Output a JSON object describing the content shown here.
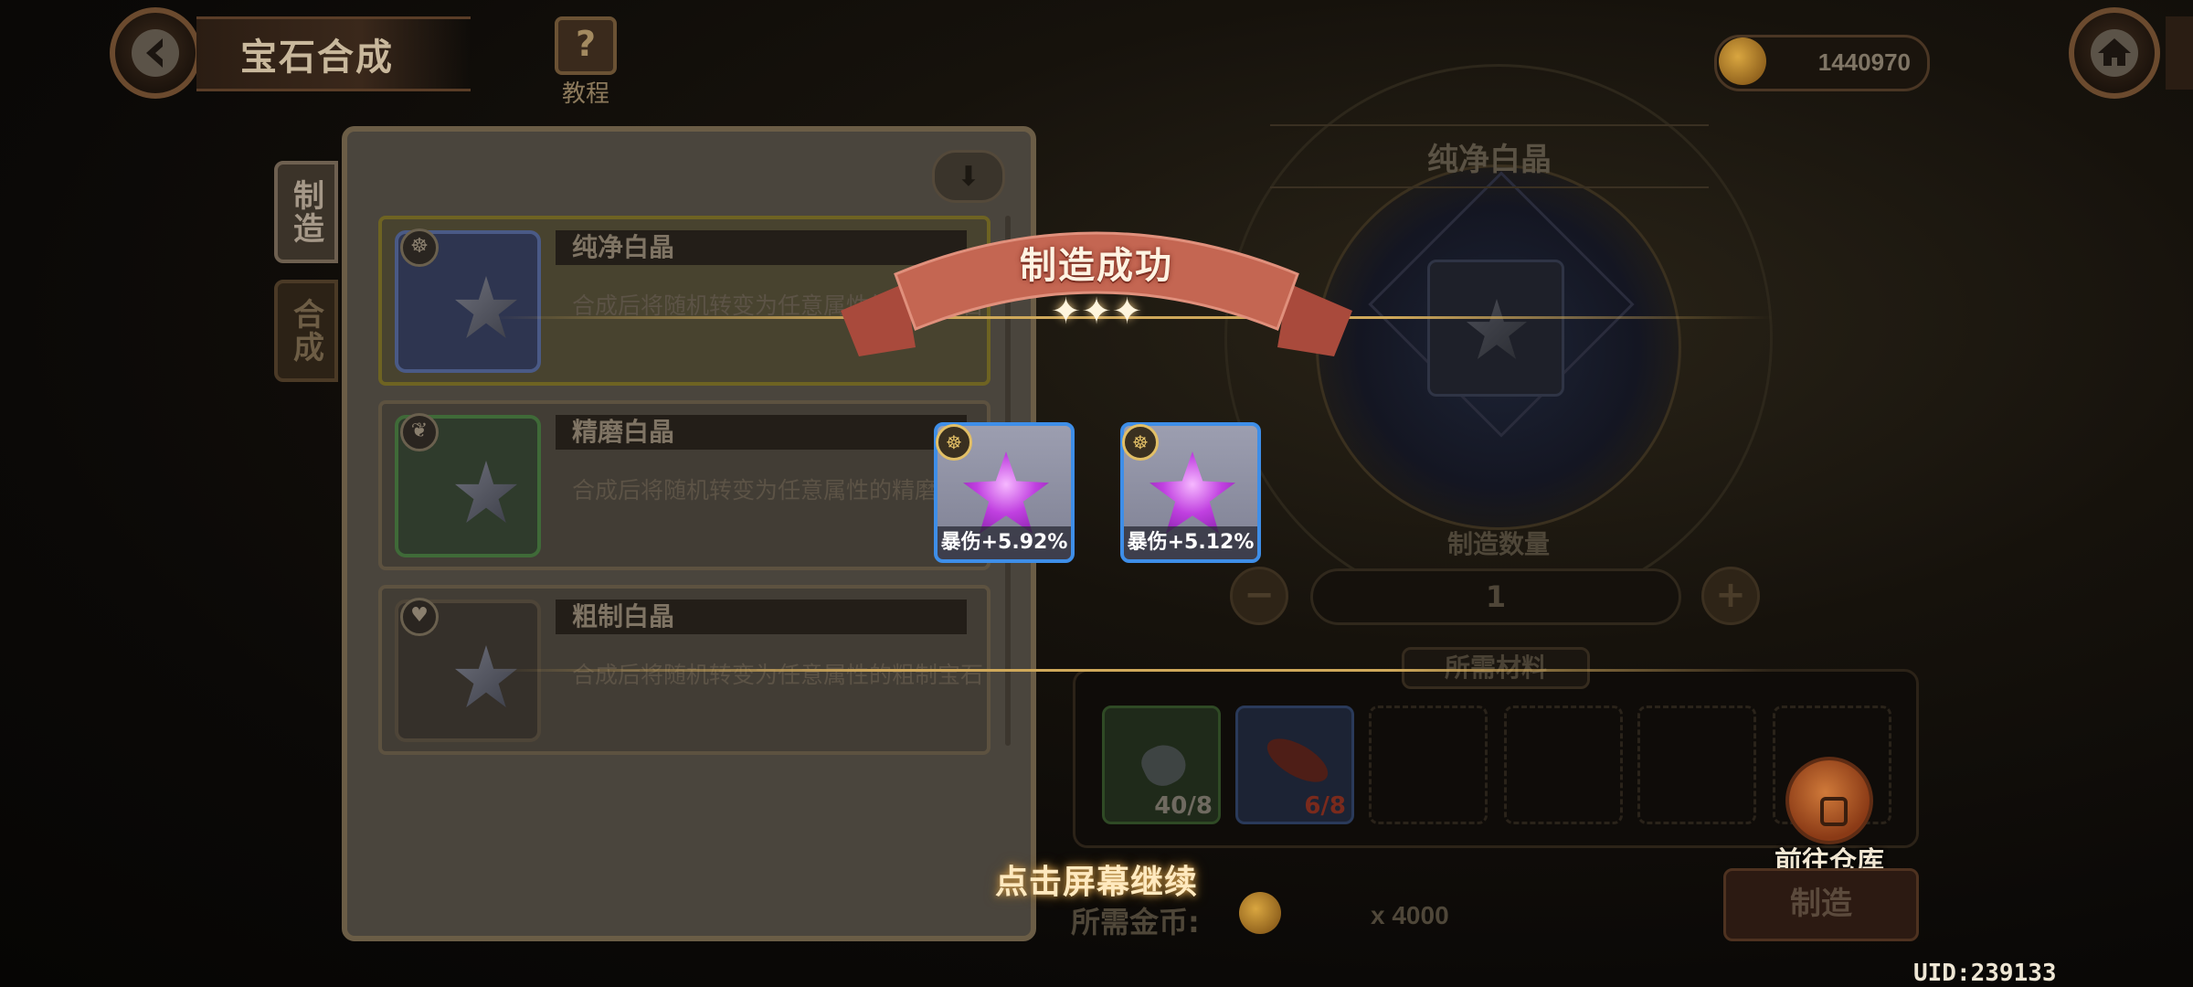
{
  "header": {
    "title": "宝石合成",
    "tutorial_label": "教程",
    "gold": "1440970"
  },
  "side_tabs": [
    {
      "label": "制造"
    },
    {
      "label": "合成"
    }
  ],
  "recipes": [
    {
      "name": "纯净白晶",
      "desc": "合成后将随机转变为任意属性的纯净宝石",
      "badge": "☸"
    },
    {
      "name": "精磨白晶",
      "desc": "合成后将随机转变为任意属性的精磨宝石",
      "badge": "❦"
    },
    {
      "name": "粗制白晶",
      "desc": "合成后将随机转变为任意属性的粗制宝石",
      "badge": "♥"
    }
  ],
  "right_panel": {
    "selected_name": "纯净白晶",
    "qty_label": "制造数量",
    "qty": "1",
    "minus": "−",
    "plus": "+",
    "materials_label": "所需材料",
    "materials": [
      {
        "count": "40/8"
      },
      {
        "count": "6/8"
      }
    ],
    "goto_warehouse": "前往仓库",
    "make_button": "制造",
    "gold_label": "所需金币:",
    "gold_amount": "x 4000"
  },
  "overlay": {
    "title": "制造成功",
    "sparkles": "✦✦✦",
    "results": [
      {
        "stat": "暴伤+5.92%"
      },
      {
        "stat": "暴伤+5.12%"
      }
    ],
    "tap_continue": "点击屏幕继续"
  },
  "uid": "UID:239133",
  "colors": {
    "accent_gold": "#cfa85a",
    "ribbon_red": "#c46652",
    "result_border": "#3e8ee8",
    "gem_purple": "#c040e0"
  },
  "icons": [
    "back-arrow-icon",
    "question-mark-icon",
    "gold-coin-icon",
    "home-icon",
    "sort-arrow-icon",
    "backpack-icon"
  ]
}
